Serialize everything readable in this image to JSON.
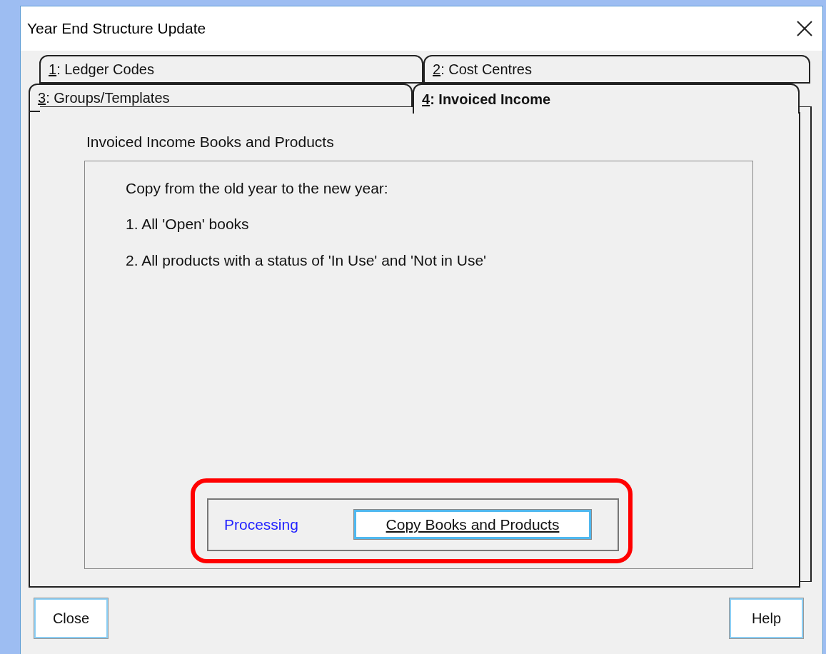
{
  "window": {
    "title": "Year End Structure Update"
  },
  "tab_rows": [
    {
      "tabs": [
        {
          "label": "1: Ledger Codes",
          "selected": false
        },
        {
          "label": "2: Cost Centres",
          "selected": false
        }
      ]
    },
    {
      "tabs": [
        {
          "label": "3: Groups/Templates",
          "selected": false
        },
        {
          "label": "4: Invoiced Income",
          "selected": true
        }
      ]
    }
  ],
  "panel": {
    "heading": "Invoiced Income Books and Products",
    "instructions": [
      "Copy from the old year to the new year:",
      "1. All 'Open' books",
      "2. All products with a status of 'In Use' and 'Not in Use'"
    ],
    "status": "Processing",
    "action_button": "Copy Books and Products"
  },
  "buttons": [
    "Close",
    "Help"
  ]
}
